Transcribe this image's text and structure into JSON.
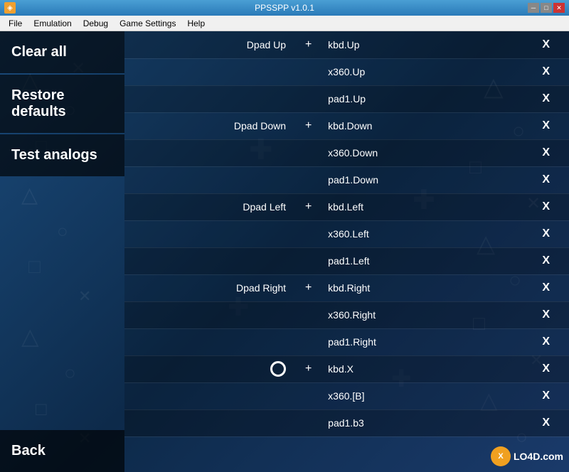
{
  "titlebar": {
    "title": "PPSSPP v1.0.1",
    "minimize_label": "─",
    "maximize_label": "□",
    "close_label": "✕"
  },
  "menubar": {
    "items": [
      {
        "label": "File"
      },
      {
        "label": "Emulation"
      },
      {
        "label": "Debug"
      },
      {
        "label": "Game Settings"
      },
      {
        "label": "Help"
      }
    ]
  },
  "sidebar": {
    "clear_all": "Clear all",
    "restore_defaults": "Restore defaults",
    "test_analogs": "Test analogs",
    "back": "Back"
  },
  "table": {
    "rows": [
      {
        "action": "Dpad Up",
        "plus": "+",
        "binding": "kbd.Up",
        "x": "X"
      },
      {
        "action": "",
        "plus": "",
        "binding": "x360.Up",
        "x": "X"
      },
      {
        "action": "",
        "plus": "",
        "binding": "pad1.Up",
        "x": "X"
      },
      {
        "action": "Dpad Down",
        "plus": "+",
        "binding": "kbd.Down",
        "x": "X"
      },
      {
        "action": "",
        "plus": "",
        "binding": "x360.Down",
        "x": "X"
      },
      {
        "action": "",
        "plus": "",
        "binding": "pad1.Down",
        "x": "X"
      },
      {
        "action": "Dpad Left",
        "plus": "+",
        "binding": "kbd.Left",
        "x": "X"
      },
      {
        "action": "",
        "plus": "",
        "binding": "x360.Left",
        "x": "X"
      },
      {
        "action": "",
        "plus": "",
        "binding": "pad1.Left",
        "x": "X"
      },
      {
        "action": "Dpad Right",
        "plus": "+",
        "binding": "kbd.Right",
        "x": "X"
      },
      {
        "action": "",
        "plus": "",
        "binding": "x360.Right",
        "x": "X"
      },
      {
        "action": "",
        "plus": "",
        "binding": "pad1.Right",
        "x": "X"
      },
      {
        "action": "circle",
        "plus": "+",
        "binding": "kbd.X",
        "x": "X"
      },
      {
        "action": "",
        "plus": "",
        "binding": "x360.[B]",
        "x": "X"
      },
      {
        "action": "",
        "plus": "",
        "binding": "pad1.b3",
        "x": "X"
      }
    ]
  },
  "watermark": {
    "logo": "X",
    "text": "LO4D.com"
  }
}
